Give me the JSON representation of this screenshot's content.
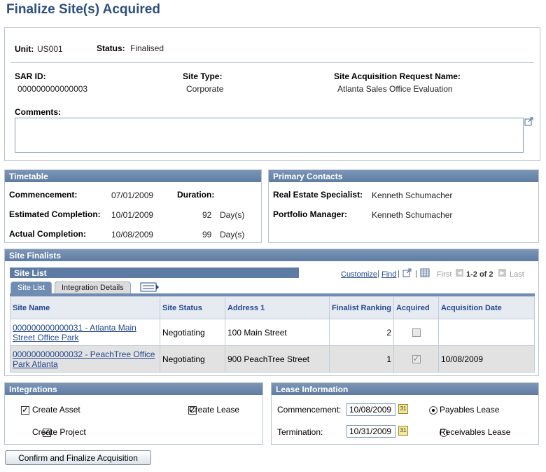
{
  "page_title": "Finalize Site(s) Acquired",
  "header": {
    "unit_label": "Unit:",
    "unit_value": "US001",
    "status_label": "Status:",
    "status_value": "Finalised",
    "sar_id_label": "SAR ID:",
    "sar_id_value": "000000000000003",
    "site_type_label": "Site Type:",
    "site_type_value": "Corporate",
    "sar_name_label": "Site Acquisition Request Name:",
    "sar_name_value": "Atlanta Sales Office Evaluation",
    "comments_label": "Comments:",
    "comments_value": ""
  },
  "timetable": {
    "title": "Timetable",
    "commencement_label": "Commencement:",
    "commencement_value": "07/01/2009",
    "duration_label": "Duration:",
    "est_completion_label": "Estimated Completion:",
    "est_completion_value": "10/01/2009",
    "est_days": "92",
    "est_unit": "Day(s)",
    "actual_completion_label": "Actual Completion:",
    "actual_completion_value": "10/08/2009",
    "actual_days": "99",
    "actual_unit": "Day(s)"
  },
  "contacts": {
    "title": "Primary Contacts",
    "res_label": "Real Estate Specialist:",
    "res_value": "Kenneth Schumacher",
    "pm_label": "Portfolio Manager:",
    "pm_value": "Kenneth Schumacher"
  },
  "finalists": {
    "title": "Site Finalists",
    "grid_title": "Site List",
    "customize": "Customize",
    "find": "Find",
    "first": "First",
    "range": "1-2 of 2",
    "last": "Last",
    "tabs": [
      "Site List",
      "Integration Details"
    ],
    "columns": [
      "Site Name",
      "Site Status",
      "Address 1",
      "Finalist Ranking",
      "Acquired",
      "Acquisition Date"
    ],
    "rows": [
      {
        "site_name": "000000000000031 - Atlanta Main Street Office Park",
        "status": "Negotiating",
        "address": "100 Main Street",
        "ranking": "2",
        "acquired": false,
        "date": ""
      },
      {
        "site_name": "000000000000032 - PeachTree Office Park Atlanta",
        "status": "Negotiating",
        "address": "900 PeachTree Street",
        "ranking": "1",
        "acquired": true,
        "date": "10/08/2009"
      }
    ]
  },
  "integrations": {
    "title": "Integrations",
    "create_asset": "Create Asset",
    "create_lease": "Create Lease",
    "create_project": "Create Project"
  },
  "lease": {
    "title": "Lease Information",
    "commencement_label": "Commencement:",
    "commencement_value": "10/08/2009",
    "termination_label": "Termination:",
    "termination_value": "10/31/2009",
    "payables": "Payables Lease",
    "receivables": "Receivables Lease"
  },
  "confirm_button": "Confirm and Finalize Acquisition"
}
